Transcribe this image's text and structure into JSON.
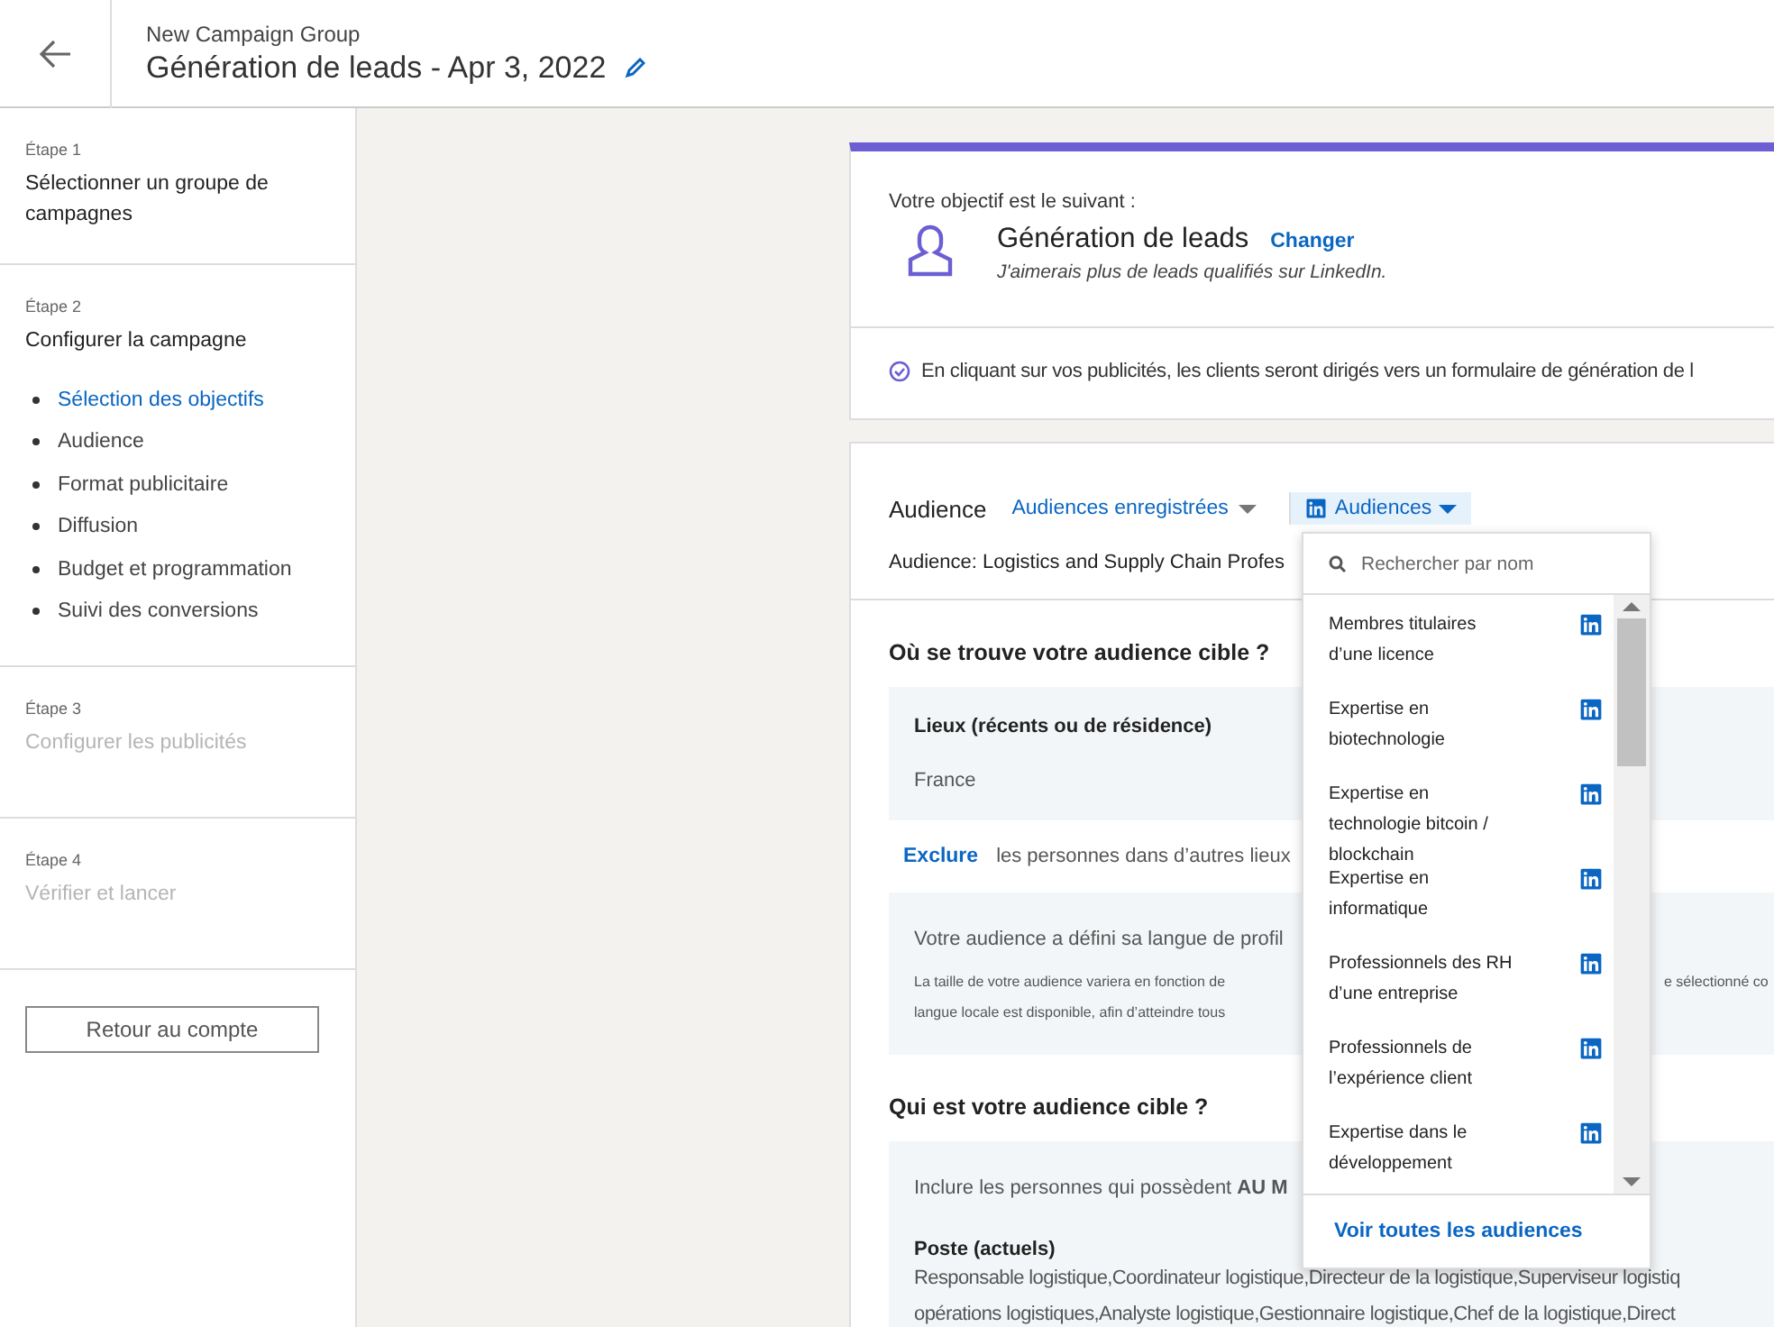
{
  "header": {
    "group": "New Campaign Group",
    "title": "Génération de leads - Apr 3, 2022"
  },
  "steps": [
    {
      "label": "Étape 1",
      "title": "Sélectionner un groupe de campagnes",
      "disabled": false
    },
    {
      "label": "Étape 2",
      "title": "Configurer la campagne",
      "disabled": false,
      "items": [
        {
          "label": "Sélection des objectifs",
          "selected": true
        },
        {
          "label": "Audience",
          "selected": false
        },
        {
          "label": "Format publicitaire",
          "selected": false
        },
        {
          "label": "Diffusion",
          "selected": false
        },
        {
          "label": "Budget et programmation",
          "selected": false
        },
        {
          "label": "Suivi des conversions",
          "selected": false
        }
      ]
    },
    {
      "label": "Étape 3",
      "title": "Configurer les publicités",
      "disabled": true
    },
    {
      "label": "Étape 4",
      "title": "Vérifier et lancer",
      "disabled": true
    }
  ],
  "back_button": "Retour au compte",
  "objective": {
    "intro": "Votre objectif est le suivant :",
    "name": "Génération de leads",
    "change": "Changer",
    "description": "J'aimerais plus de leads qualifiés sur LinkedIn.",
    "note": "En cliquant sur vos publicités, les clients seront dirigés vers un formulaire de génération de l"
  },
  "audience": {
    "title": "Audience",
    "saved": "Audiences enregistrées",
    "audiences": "Audiences",
    "current": "Audience: Logistics and Supply Chain Profes",
    "where_title": "Où se trouve votre audience cible ?",
    "places_title": "Lieux (récents ou de résidence)",
    "places_value": "France",
    "exclude": "Exclure",
    "exclude_text": "les personnes dans d’autres lieux",
    "language_title": "Votre audience a défini sa langue de profil",
    "language_line_1": "La taille de votre audience variera en fonction de",
    "language_line_1_end": "e sélectionné co",
    "language_line_2": "langue locale est disponible, afin d’atteindre tous",
    "who_title": "Qui est votre audience cible ?",
    "include": "Inclure les personnes qui possèdent **AU M**",
    "job_title": "Poste (actuels)",
    "job_lines": [
      "Responsable logistique,Coordinateur logistique,Directeur de la logistique,Superviseur logistiq",
      "opérations logistiques,Analyste logistique,Gestionnaire logistique,Chef de la logistique,Direct"
    ]
  },
  "dropdown": {
    "placeholder": "Rechercher par nom",
    "footer": "Voir toutes les audiences",
    "items": [
      "Membres titulaires d’une licence",
      "Expertise en biotechnologie",
      "Expertise en technologie bitcoin / blockchain",
      "Expertise en informatique",
      "Professionnels des RH d’une entreprise",
      "Professionnels de l’expérience client",
      "Expertise dans le développement"
    ]
  }
}
